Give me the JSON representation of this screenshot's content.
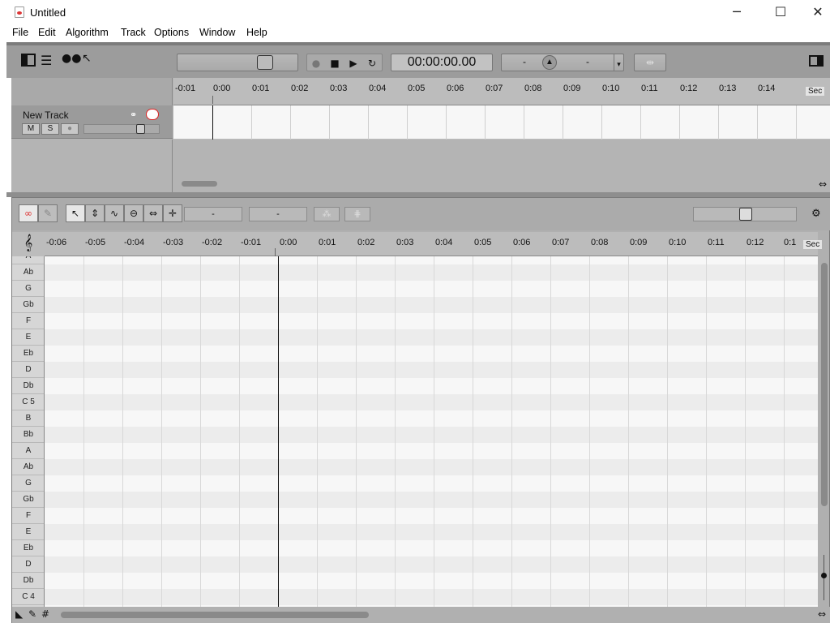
{
  "window": {
    "title": "Untitled",
    "minimize_glyph": "─",
    "maximize_glyph": "☐",
    "close_glyph": "✕"
  },
  "menu": [
    "File",
    "Edit",
    "Algorithm",
    "Track",
    "Options",
    "Window",
    "Help"
  ],
  "toolbar": {
    "time": "00:00:00.00",
    "pitch_left": "-",
    "pitch_right": "-"
  },
  "top_ruler": {
    "unit": "Sec",
    "labels": [
      "-0:01",
      "0:00",
      "0:01",
      "0:02",
      "0:03",
      "0:04",
      "0:05",
      "0:06",
      "0:07",
      "0:08",
      "0:09",
      "0:10",
      "0:11",
      "0:12",
      "0:13",
      "0:14"
    ]
  },
  "track": {
    "name": "New Track",
    "mute_label": "M",
    "solo_label": "S"
  },
  "editor": {
    "field_left": "-",
    "field_right": "-",
    "ruler_unit": "Sec",
    "ruler_labels": [
      "-0:06",
      "-0:05",
      "-0:04",
      "-0:03",
      "-0:02",
      "-0:01",
      "0:00",
      "0:01",
      "0:02",
      "0:03",
      "0:04",
      "0:05",
      "0:06",
      "0:07",
      "0:08",
      "0:09",
      "0:10",
      "0:11",
      "0:12",
      "0:1"
    ],
    "keys": [
      "A",
      "Ab",
      "G",
      "Gb",
      "F",
      "E",
      "Eb",
      "D",
      "Db",
      "C 5",
      "B",
      "Bb",
      "A",
      "Ab",
      "G",
      "Gb",
      "F",
      "E",
      "Eb",
      "D",
      "Db",
      "C 4"
    ]
  }
}
